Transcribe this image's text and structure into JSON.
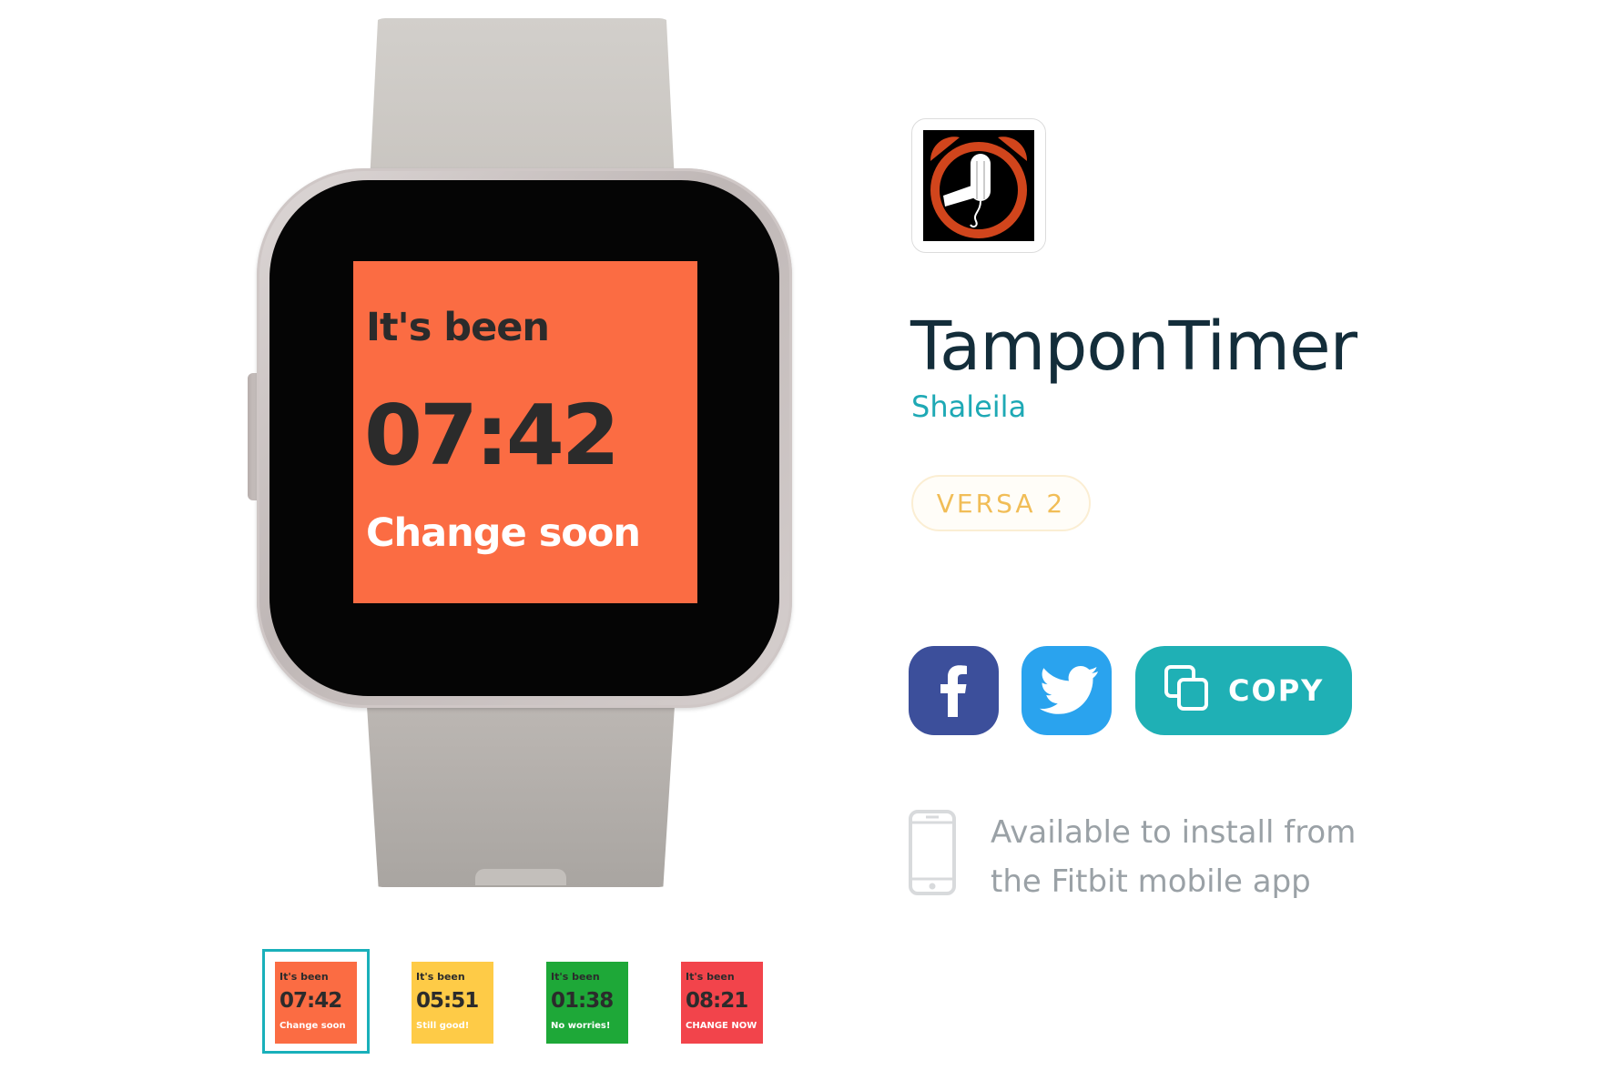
{
  "watch_screen": {
    "label": "It's been",
    "time": "07:42",
    "message": "Change soon",
    "bg_color": "#fb6c43"
  },
  "thumbnails": [
    {
      "label": "It's been",
      "time": "07:42",
      "message": "Change soon",
      "bg_color": "#fb6c43",
      "selected": true
    },
    {
      "label": "It's been",
      "time": "05:51",
      "message": "Still good!",
      "bg_color": "#fecb47",
      "selected": false
    },
    {
      "label": "It's been",
      "time": "01:38",
      "message": "No worries!",
      "bg_color": "#1ea838",
      "selected": false
    },
    {
      "label": "It's been",
      "time": "08:21",
      "message": "CHANGE NOW",
      "bg_color": "#f2444b",
      "selected": false
    }
  ],
  "app": {
    "icon": "alarm-clock-tampon-icon",
    "title": "TamponTimer",
    "author": "Shaleila",
    "device": "VERSA 2"
  },
  "share": {
    "facebook_icon": "facebook-icon",
    "twitter_icon": "twitter-icon",
    "copy_icon": "copy-icon",
    "copy_label": "COPY"
  },
  "install": {
    "icon": "smartphone-icon",
    "line1": "Available to install from",
    "line2": "the Fitbit mobile app"
  },
  "colors": {
    "accent": "#1fb0b5",
    "title": "#132d3a",
    "facebook": "#3c4f9b",
    "twitter": "#2aa3ee",
    "device_pill_text": "#f1bd57"
  }
}
